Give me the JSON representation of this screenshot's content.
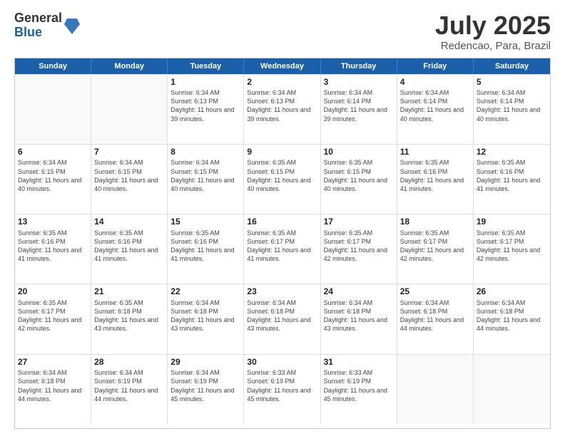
{
  "logo": {
    "general": "General",
    "blue": "Blue"
  },
  "title": {
    "month": "July 2025",
    "location": "Redencao, Para, Brazil"
  },
  "header_days": [
    "Sunday",
    "Monday",
    "Tuesday",
    "Wednesday",
    "Thursday",
    "Friday",
    "Saturday"
  ],
  "weeks": [
    [
      {
        "day": "",
        "info": ""
      },
      {
        "day": "",
        "info": ""
      },
      {
        "day": "1",
        "info": "Sunrise: 6:34 AM\nSunset: 6:13 PM\nDaylight: 11 hours and 39 minutes."
      },
      {
        "day": "2",
        "info": "Sunrise: 6:34 AM\nSunset: 6:13 PM\nDaylight: 11 hours and 39 minutes."
      },
      {
        "day": "3",
        "info": "Sunrise: 6:34 AM\nSunset: 6:14 PM\nDaylight: 11 hours and 39 minutes."
      },
      {
        "day": "4",
        "info": "Sunrise: 6:34 AM\nSunset: 6:14 PM\nDaylight: 11 hours and 40 minutes."
      },
      {
        "day": "5",
        "info": "Sunrise: 6:34 AM\nSunset: 6:14 PM\nDaylight: 11 hours and 40 minutes."
      }
    ],
    [
      {
        "day": "6",
        "info": "Sunrise: 6:34 AM\nSunset: 6:15 PM\nDaylight: 11 hours and 40 minutes."
      },
      {
        "day": "7",
        "info": "Sunrise: 6:34 AM\nSunset: 6:15 PM\nDaylight: 11 hours and 40 minutes."
      },
      {
        "day": "8",
        "info": "Sunrise: 6:34 AM\nSunset: 6:15 PM\nDaylight: 11 hours and 40 minutes."
      },
      {
        "day": "9",
        "info": "Sunrise: 6:35 AM\nSunset: 6:15 PM\nDaylight: 11 hours and 40 minutes."
      },
      {
        "day": "10",
        "info": "Sunrise: 6:35 AM\nSunset: 6:15 PM\nDaylight: 11 hours and 40 minutes."
      },
      {
        "day": "11",
        "info": "Sunrise: 6:35 AM\nSunset: 6:16 PM\nDaylight: 11 hours and 41 minutes."
      },
      {
        "day": "12",
        "info": "Sunrise: 6:35 AM\nSunset: 6:16 PM\nDaylight: 11 hours and 41 minutes."
      }
    ],
    [
      {
        "day": "13",
        "info": "Sunrise: 6:35 AM\nSunset: 6:16 PM\nDaylight: 11 hours and 41 minutes."
      },
      {
        "day": "14",
        "info": "Sunrise: 6:35 AM\nSunset: 6:16 PM\nDaylight: 11 hours and 41 minutes."
      },
      {
        "day": "15",
        "info": "Sunrise: 6:35 AM\nSunset: 6:16 PM\nDaylight: 11 hours and 41 minutes."
      },
      {
        "day": "16",
        "info": "Sunrise: 6:35 AM\nSunset: 6:17 PM\nDaylight: 11 hours and 41 minutes."
      },
      {
        "day": "17",
        "info": "Sunrise: 6:35 AM\nSunset: 6:17 PM\nDaylight: 11 hours and 42 minutes."
      },
      {
        "day": "18",
        "info": "Sunrise: 6:35 AM\nSunset: 6:17 PM\nDaylight: 11 hours and 42 minutes."
      },
      {
        "day": "19",
        "info": "Sunrise: 6:35 AM\nSunset: 6:17 PM\nDaylight: 11 hours and 42 minutes."
      }
    ],
    [
      {
        "day": "20",
        "info": "Sunrise: 6:35 AM\nSunset: 6:17 PM\nDaylight: 11 hours and 42 minutes."
      },
      {
        "day": "21",
        "info": "Sunrise: 6:35 AM\nSunset: 6:18 PM\nDaylight: 11 hours and 43 minutes."
      },
      {
        "day": "22",
        "info": "Sunrise: 6:34 AM\nSunset: 6:18 PM\nDaylight: 11 hours and 43 minutes."
      },
      {
        "day": "23",
        "info": "Sunrise: 6:34 AM\nSunset: 6:18 PM\nDaylight: 11 hours and 43 minutes."
      },
      {
        "day": "24",
        "info": "Sunrise: 6:34 AM\nSunset: 6:18 PM\nDaylight: 11 hours and 43 minutes."
      },
      {
        "day": "25",
        "info": "Sunrise: 6:34 AM\nSunset: 6:18 PM\nDaylight: 11 hours and 44 minutes."
      },
      {
        "day": "26",
        "info": "Sunrise: 6:34 AM\nSunset: 6:18 PM\nDaylight: 11 hours and 44 minutes."
      }
    ],
    [
      {
        "day": "27",
        "info": "Sunrise: 6:34 AM\nSunset: 6:18 PM\nDaylight: 11 hours and 44 minutes."
      },
      {
        "day": "28",
        "info": "Sunrise: 6:34 AM\nSunset: 6:19 PM\nDaylight: 11 hours and 44 minutes."
      },
      {
        "day": "29",
        "info": "Sunrise: 6:34 AM\nSunset: 6:19 PM\nDaylight: 11 hours and 45 minutes."
      },
      {
        "day": "30",
        "info": "Sunrise: 6:33 AM\nSunset: 6:19 PM\nDaylight: 11 hours and 45 minutes."
      },
      {
        "day": "31",
        "info": "Sunrise: 6:33 AM\nSunset: 6:19 PM\nDaylight: 11 hours and 45 minutes."
      },
      {
        "day": "",
        "info": ""
      },
      {
        "day": "",
        "info": ""
      }
    ]
  ]
}
